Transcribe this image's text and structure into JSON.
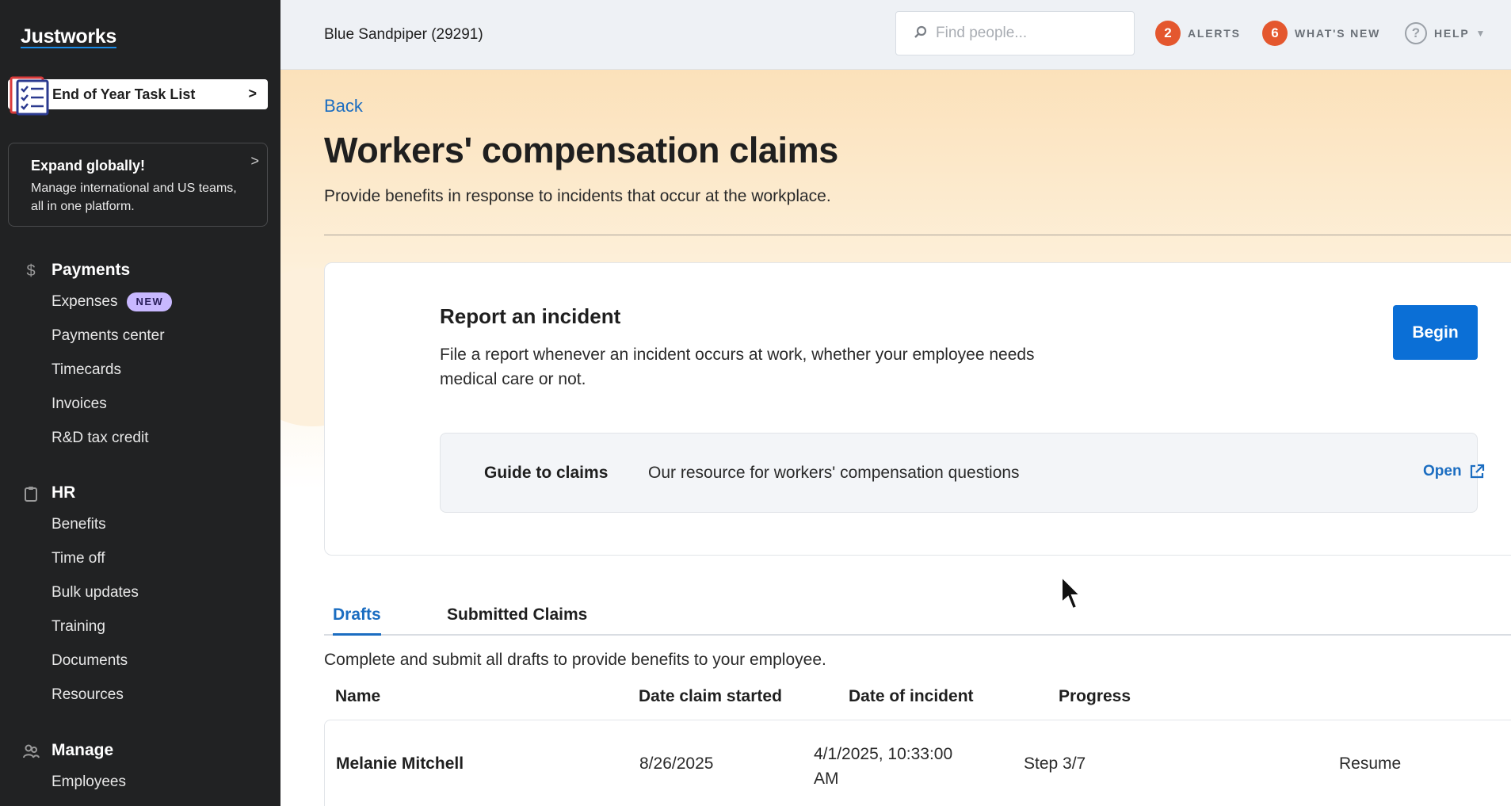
{
  "sidebar": {
    "logo": "Justworks",
    "task_list": {
      "label": "End of Year Task List"
    },
    "promo": {
      "title": "Expand globally!",
      "body": "Manage international and US teams, all in one platform."
    },
    "sections": [
      {
        "heading": "Payments",
        "icon": "dollar-icon",
        "items": [
          {
            "label": "Expenses",
            "badge": "NEW"
          },
          {
            "label": "Payments center"
          },
          {
            "label": "Timecards"
          },
          {
            "label": "Invoices"
          },
          {
            "label": "R&D tax credit"
          }
        ]
      },
      {
        "heading": "HR",
        "icon": "clipboard-icon",
        "items": [
          {
            "label": "Benefits"
          },
          {
            "label": "Time off"
          },
          {
            "label": "Bulk updates"
          },
          {
            "label": "Training"
          },
          {
            "label": "Documents"
          },
          {
            "label": "Resources"
          }
        ]
      },
      {
        "heading": "Manage",
        "icon": "people-icon",
        "items": [
          {
            "label": "Employees"
          }
        ]
      }
    ]
  },
  "header": {
    "company": "Blue Sandpiper (29291)",
    "search_placeholder": "Find people...",
    "alerts": {
      "count": "2",
      "label": "ALERTS"
    },
    "whats_new": {
      "count": "6",
      "label": "WHAT'S NEW"
    },
    "help": {
      "label": "HELP"
    }
  },
  "page": {
    "back": "Back",
    "title": "Workers' compensation claims",
    "subtitle": "Provide benefits in response to incidents that occur at the workplace."
  },
  "report_card": {
    "title": "Report an incident",
    "body": "File a report whenever an incident occurs at work, whether your employee needs medical care or not.",
    "begin_label": "Begin",
    "guide": {
      "title": "Guide to claims",
      "description": "Our resource for workers' compensation questions",
      "open_label": "Open"
    }
  },
  "tabs": {
    "items": [
      "Drafts",
      "Submitted Claims"
    ],
    "active": "Drafts",
    "description": "Complete and submit all drafts to provide benefits to your employee."
  },
  "table": {
    "columns": [
      "Name",
      "Date claim started",
      "Date of incident",
      "Progress"
    ],
    "rows": [
      {
        "name": "Melanie Mitchell",
        "date_started": "8/26/2025",
        "date_incident_line1": "4/1/2025, 10:33:00",
        "date_incident_line2": "AM",
        "progress": "Step 3/7",
        "action": "Resume"
      }
    ]
  },
  "colors": {
    "sidebar_bg": "#212223",
    "accent_blue": "#0b6fd6",
    "link_blue": "#1b6dc1",
    "alert_orange": "#e4572e",
    "badge_purple": "#c8b8ff"
  }
}
